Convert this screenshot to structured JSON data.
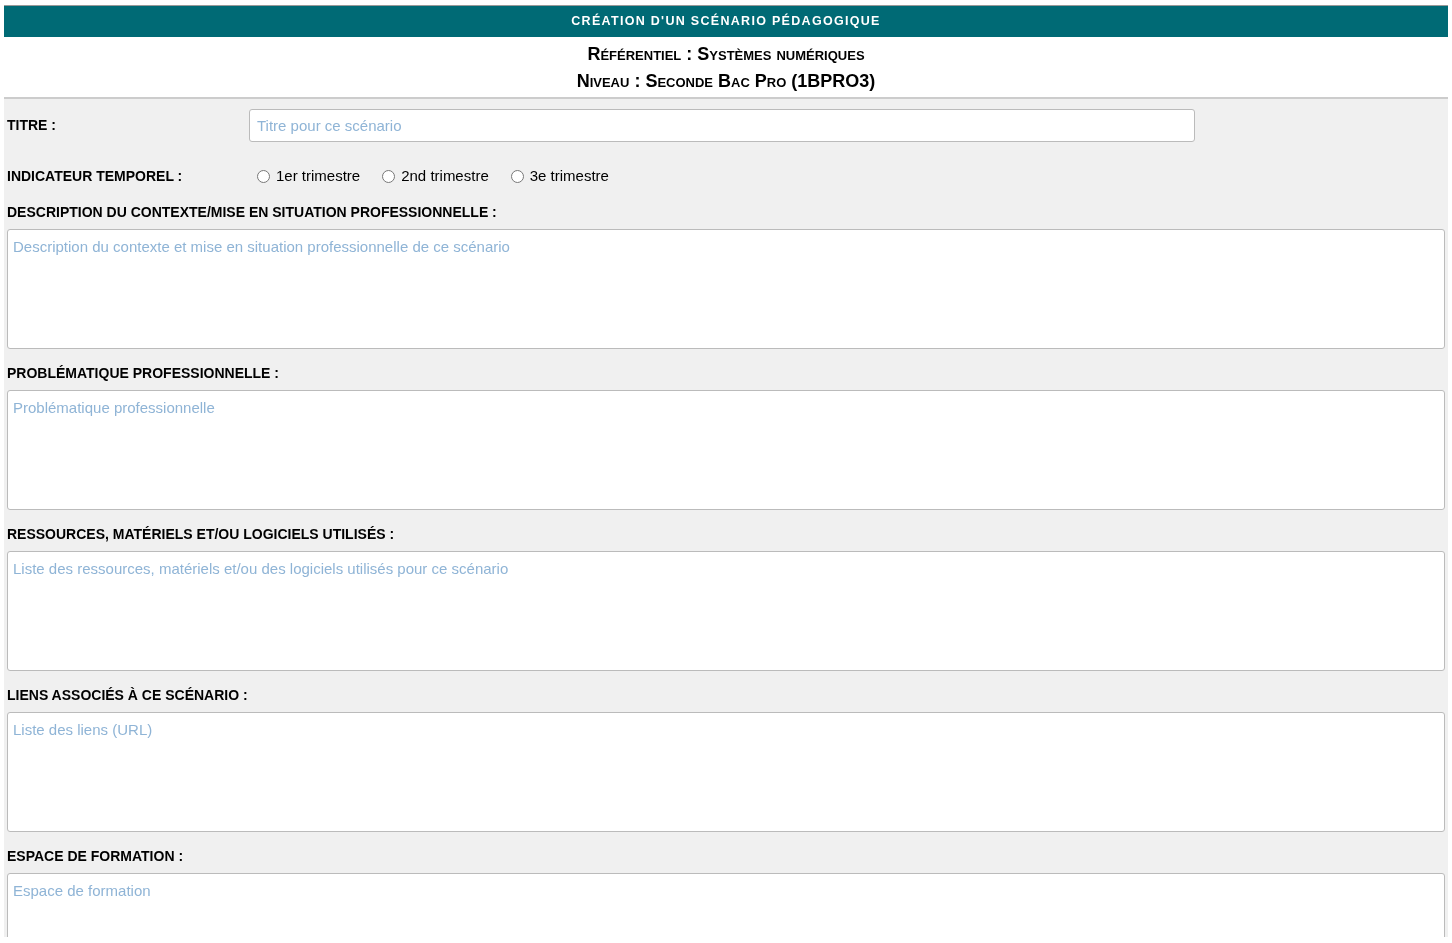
{
  "title_bar": "CRÉATION D'UN SCÉNARIO PÉDAGOGIQUE",
  "header_lines": [
    "Référentiel : Systèmes numériques",
    "Niveau : Seconde Bac Pro (1BPRO3)"
  ],
  "title_field": {
    "label": "TITRE :",
    "placeholder": "Titre pour ce scénario"
  },
  "period": {
    "label": "INDICATEUR TEMPOREL :",
    "options": [
      {
        "label": "1er trimestre",
        "selected": false
      },
      {
        "label": "2nd trimestre",
        "selected": false
      },
      {
        "label": "3e trimestre",
        "selected": false
      }
    ]
  },
  "sections": [
    {
      "label": "DESCRIPTION DU CONTEXTE/MISE EN SITUATION PROFESSIONNELLE :",
      "placeholder": "Description du contexte et mise en situation professionnelle de ce scénario"
    },
    {
      "label": "PROBLÉMATIQUE PROFESSIONNELLE :",
      "placeholder": "Problématique professionnelle"
    },
    {
      "label": "RESSOURCES, MATÉRIELS ET/OU LOGICIELS UTILISÉS :",
      "placeholder": "Liste des ressources, matériels et/ou des logiciels utilisés pour ce scénario"
    },
    {
      "label": "LIENS ASSOCIÉS À CE SCÉNARIO :",
      "placeholder": "Liste des liens (URL)"
    },
    {
      "label": "ESPACE DE FORMATION :",
      "placeholder": "Espace de formation"
    }
  ]
}
